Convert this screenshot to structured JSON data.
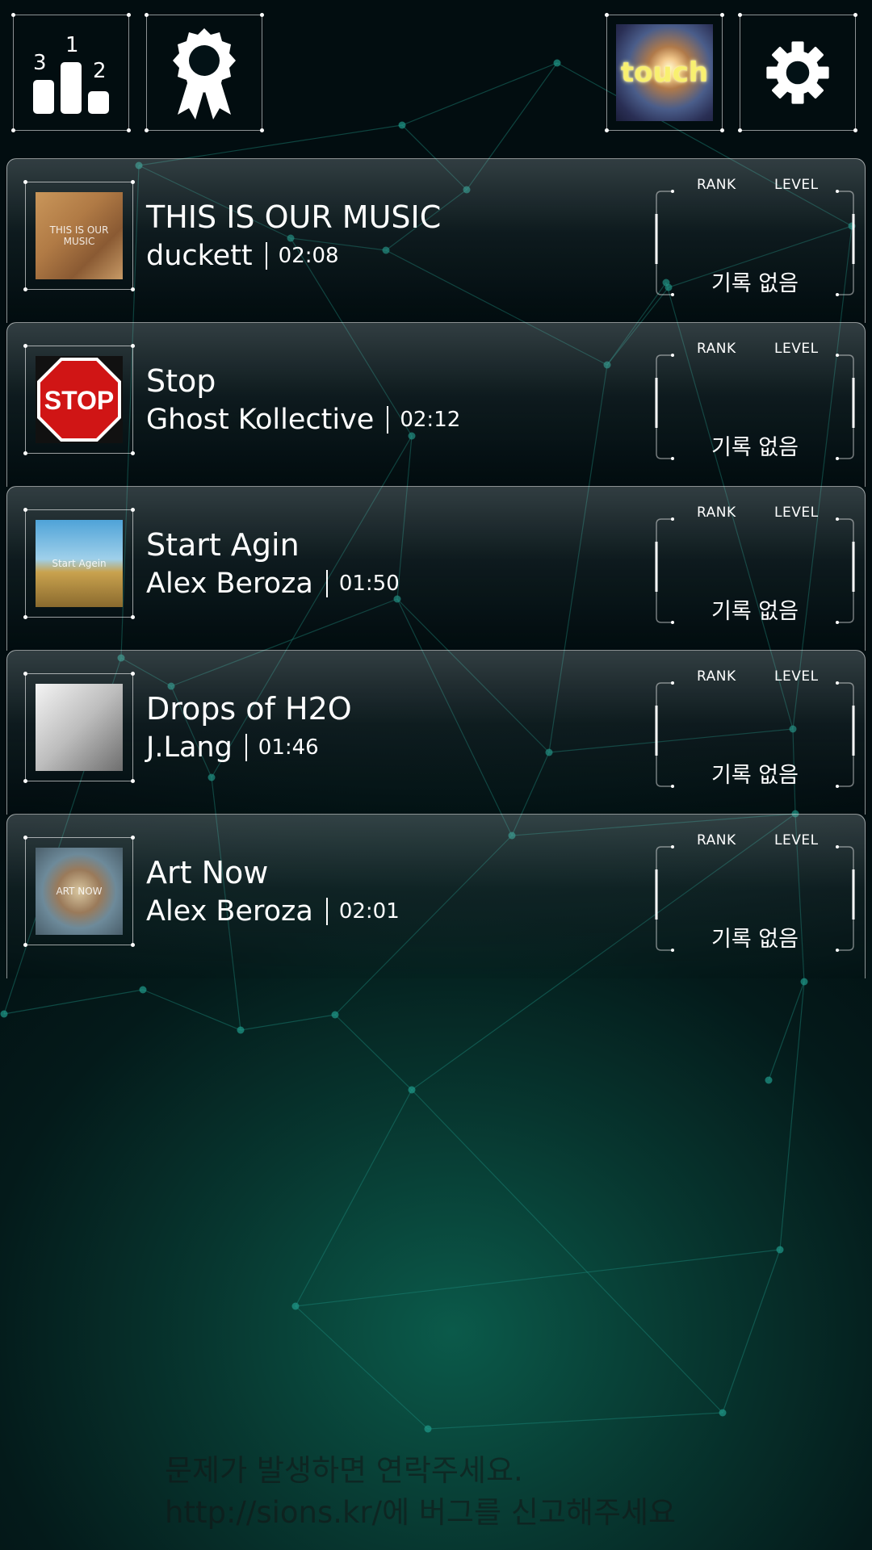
{
  "toolbar": {
    "ranking_digits": [
      "3",
      "1",
      "2"
    ],
    "touch_label": "touch"
  },
  "rank_labels": {
    "rank": "RANK",
    "level": "LEVEL"
  },
  "songs": [
    {
      "title": "THIS IS OUR MUSIC",
      "artist": "duckett",
      "duration": "02:08",
      "record": "기록 없음",
      "art_text": "THIS IS OUR MUSIC",
      "art": "album-cover-this-is-our-music"
    },
    {
      "title": "Stop",
      "artist": "Ghost Kollective",
      "duration": "02:12",
      "record": "기록 없음",
      "art_text": "STOP",
      "art": "stop-sign"
    },
    {
      "title": "Start Agin",
      "artist": "Alex Beroza",
      "duration": "01:50",
      "record": "기록 없음",
      "art_text": "Start Agein",
      "art": "album-cover-start-agin"
    },
    {
      "title": "Drops of H2O",
      "artist": "J.Lang",
      "duration": "01:46",
      "record": "기록 없음",
      "art_text": "",
      "art": "album-cover-drops-of-h2o"
    },
    {
      "title": "Art Now",
      "artist": "Alex Beroza",
      "duration": "02:01",
      "record": "기록 없음",
      "art_text": "ART NOW",
      "art": "album-cover-art-now"
    }
  ],
  "footer": {
    "line1": "문제가 발생하면 연락주세요.",
    "line2": "http://sions.kr/에 버그를 신고해주세요"
  },
  "colors": {
    "accent": "#1f8a7a",
    "background": "#041a1a",
    "stop_red": "#d01515"
  }
}
